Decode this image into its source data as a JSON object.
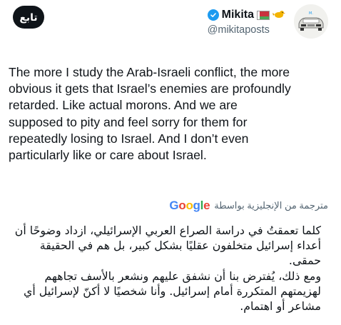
{
  "header": {
    "follow_label": "تابع",
    "display_name": "Mikita",
    "handle": "@mikitaposts"
  },
  "tweet": {
    "text": "The more I study the Arab-Israeli conflict, the more\nobvious it gets that Israel’s enemies are profoundly\nretarded. Like actual morons. And we are\nsupposed to pity and feel sorry for them for\nrepeatedly losing to Israel. And I don’t even\nparticularly like or care about Israel."
  },
  "translation": {
    "label": "مترجمة من الإنجليزية بواسطة",
    "provider": "Google",
    "text": "كلما تعمقتُ في دراسة الصراع العربي الإسرائيلي، ازداد وضوحًا أن\nأعداء إسرائيل متخلفون عقليًا بشكل كبير، بل هم في الحقيقة حمقى.\nومع ذلك، يُفترض بنا أن نشفق عليهم ونشعر بالأسف تجاههم\nلهزيمتهم المتكررة أمام إسرائيل. وأنا شخصيًا لا أكنّ لإسرائيل أي\nمشاعر أو اهتمام."
  },
  "colors": {
    "text": "#0f1419",
    "secondary": "#536471",
    "verified": "#1d9bf0",
    "follow_bg": "#0f1419"
  },
  "icons": {
    "verified": "verified-badge-icon",
    "flag": "belarus-flag-icon",
    "bird": "bird-emoji-icon",
    "avatar": "car-avatar"
  }
}
